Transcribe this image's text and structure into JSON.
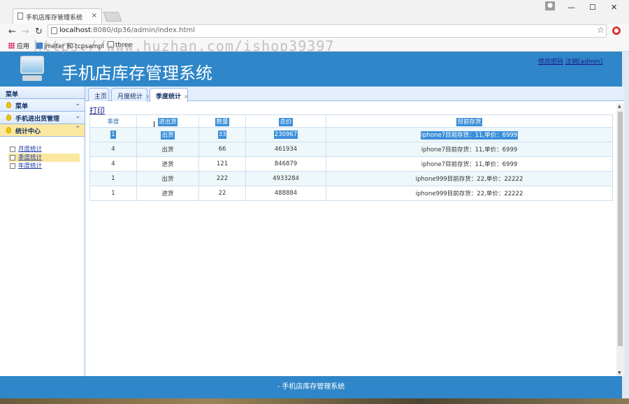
{
  "browser": {
    "tab_title": "手机店库存管理系统",
    "tab_close": "×",
    "url_host": "localhost",
    "url_path": ":8080/dp36/admin/index.html",
    "bookmarks": [
      "应用",
      "jmeter 和 tcpsampl",
      "three"
    ],
    "watermark": "https://www.huzhan.com/ishop39397",
    "window_controls": [
      "—",
      "☐",
      "✕"
    ]
  },
  "header": {
    "system_title": "手机店库存管理系统",
    "links": [
      "修改密码",
      "注销[admin]"
    ]
  },
  "sidebar": {
    "title": "菜单",
    "sections": [
      {
        "label": "菜单",
        "chevron": "⌄"
      },
      {
        "label": "手机进出货管理",
        "chevron": "⌄"
      },
      {
        "label": "统计中心",
        "chevron": "⌃"
      }
    ],
    "stats_items": [
      "月度统计",
      "季度统计",
      "年度统计"
    ]
  },
  "tabs": [
    {
      "label": "主页"
    },
    {
      "label": "月度统计",
      "close": "×"
    },
    {
      "label": "季度统计",
      "close": "×"
    }
  ],
  "print_label": "打印",
  "table": {
    "headers": [
      "季度",
      "进出货",
      "数量",
      "总价",
      "目前存货"
    ],
    "rows": [
      [
        "1",
        "出货",
        "33",
        "230967",
        "iphone7目前存货：11,单价：6999"
      ],
      [
        "4",
        "出货",
        "66",
        "461934",
        "iphone7目前存货：11,单价：6999"
      ],
      [
        "4",
        "进货",
        "121",
        "846879",
        "iphone7目前存货：11,单价：6999"
      ],
      [
        "1",
        "出货",
        "222",
        "4933284",
        "iphone999目前存货：22,单价：22222"
      ],
      [
        "1",
        "进货",
        "22",
        "488884",
        "iphone999目前存货：22,单价：22222"
      ]
    ]
  },
  "footer": "- 手机店库存管理系统",
  "colors": {
    "header_blue": "#2f86c8",
    "accent_yellow": "#fbe8a0",
    "selection_blue": "#3a8fd9"
  }
}
